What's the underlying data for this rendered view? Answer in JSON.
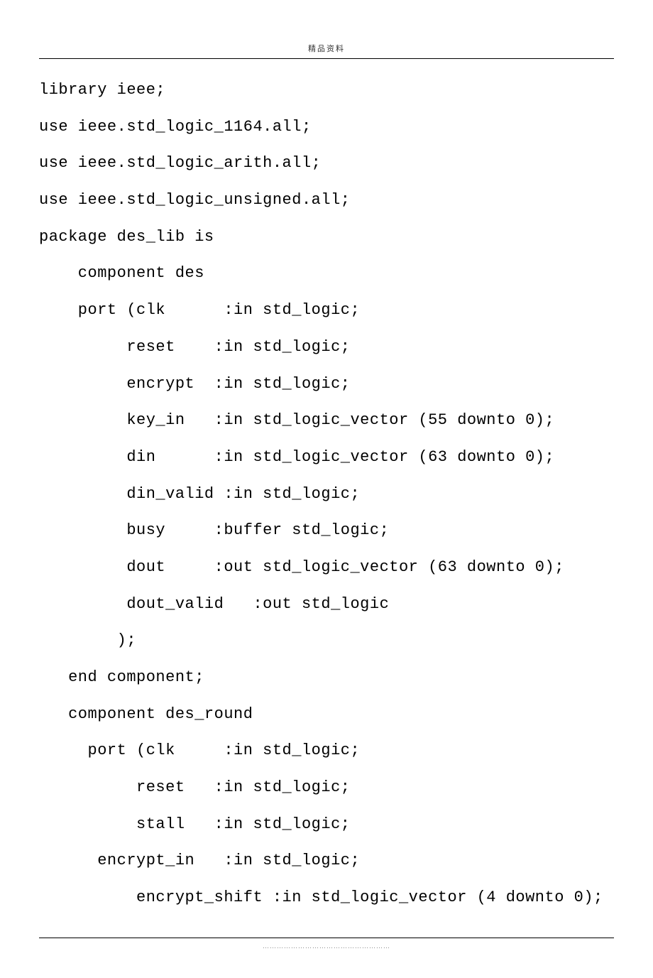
{
  "header": "精品资料",
  "code_lines": [
    "library ieee;",
    "use ieee.std_logic_1164.all;",
    "use ieee.std_logic_arith.all;",
    "use ieee.std_logic_unsigned.all;",
    "package des_lib is",
    "    component des",
    "    port (clk      :in std_logic;",
    "         reset    :in std_logic;",
    "         encrypt  :in std_logic;",
    "         key_in   :in std_logic_vector (55 downto 0);",
    "         din      :in std_logic_vector (63 downto 0);",
    "         din_valid :in std_logic;",
    "         busy     :buffer std_logic;",
    "         dout     :out std_logic_vector (63 downto 0);",
    "         dout_valid   :out std_logic",
    "        );",
    "   end component;",
    "   component des_round",
    "     port (clk     :in std_logic;",
    "          reset   :in std_logic;",
    "          stall   :in std_logic;",
    "      encrypt_in   :in std_logic;",
    "          encrypt_shift :in std_logic_vector (4 downto 0);"
  ],
  "footer_dots": "………………………………………………"
}
